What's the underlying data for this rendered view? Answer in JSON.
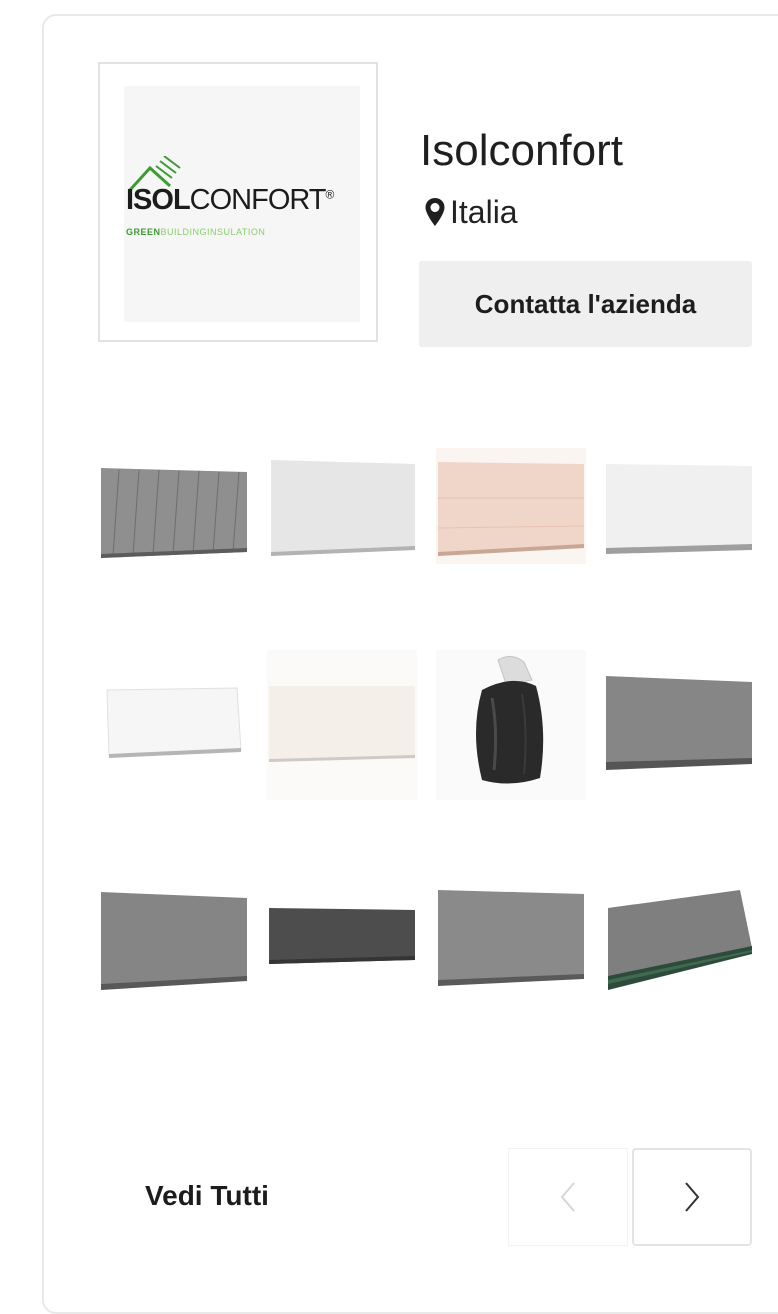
{
  "company": {
    "name": "Isolconfort",
    "location": "Italia",
    "contact_label": "Contatta l'azienda"
  },
  "logo": {
    "word_bold": "ISOL",
    "word_regular": "CONFORT",
    "registered": "®",
    "tag_strong": "GREEN",
    "tag_light": "BUILDINGINSULATION"
  },
  "products": [
    {
      "icon": "grey-striped-insulation-panel"
    },
    {
      "icon": "light-grey-insulation-panel"
    },
    {
      "icon": "pink-insulation-panel"
    },
    {
      "icon": "white-insulation-panel"
    },
    {
      "icon": "white-insulation-board"
    },
    {
      "icon": "cream-insulation-panel"
    },
    {
      "icon": "black-insulation-bag"
    },
    {
      "icon": "grey-insulation-panel"
    },
    {
      "icon": "grey-insulation-panel"
    },
    {
      "icon": "dark-grey-insulation-panel"
    },
    {
      "icon": "grey-insulation-panel"
    },
    {
      "icon": "grey-green-edge-insulation-panel"
    }
  ],
  "footer": {
    "see_all_label": "Vedi Tutti"
  },
  "colors": {
    "brand_green": "#3f9a33",
    "button_bg": "#efefef"
  }
}
